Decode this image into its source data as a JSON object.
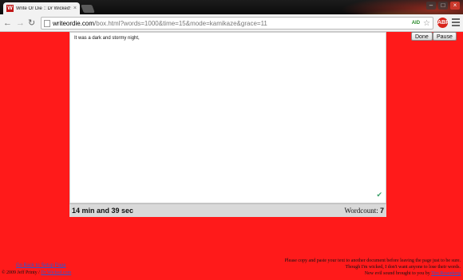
{
  "browser": {
    "tab_title": "Write Or Die :: Dr Wicked's W",
    "tab_favicon": "W",
    "tab_close": "×",
    "window_controls": {
      "minimize": "–",
      "maximize": "□",
      "close": "×"
    },
    "url_host": "writeordie.com",
    "url_path": "/box.html?words=1000&time=15&mode=kamikaze&grace=11",
    "ext_badge": "AID",
    "adblock_badge": "ABP"
  },
  "icons": {
    "back": "back-arrow-icon",
    "forward": "forward-arrow-icon",
    "reload": "reload-icon",
    "star": "bookmark-star-icon",
    "menu": "hamburger-menu-icon",
    "check": "spellcheck-check-icon"
  },
  "controls": {
    "done": "Done",
    "pause": "Pause"
  },
  "editor": {
    "text": "It was a dark and stormy night,"
  },
  "status": {
    "timer": "14 min and 39 sec",
    "wordcount_label": "Wordcount:",
    "wordcount_value": "7"
  },
  "footer": {
    "back_link": "Go Back to Setup Page",
    "copyright_text": "© 2009 Jeff Printy / ",
    "copyright_link": "Dr Wicked.com",
    "note1": "Please copy and paste your text to another document before leaving the page just to be sure.",
    "note2": "Though I'm wicked, I don't want anyone to lose their words.",
    "note3_text": "New evil sound brought to you by ",
    "note3_link": "Tim Rosenberg"
  },
  "colors": {
    "page_background": "#ff1a1a",
    "status_bar": "#d9d9d9",
    "link": "#3355cc"
  }
}
